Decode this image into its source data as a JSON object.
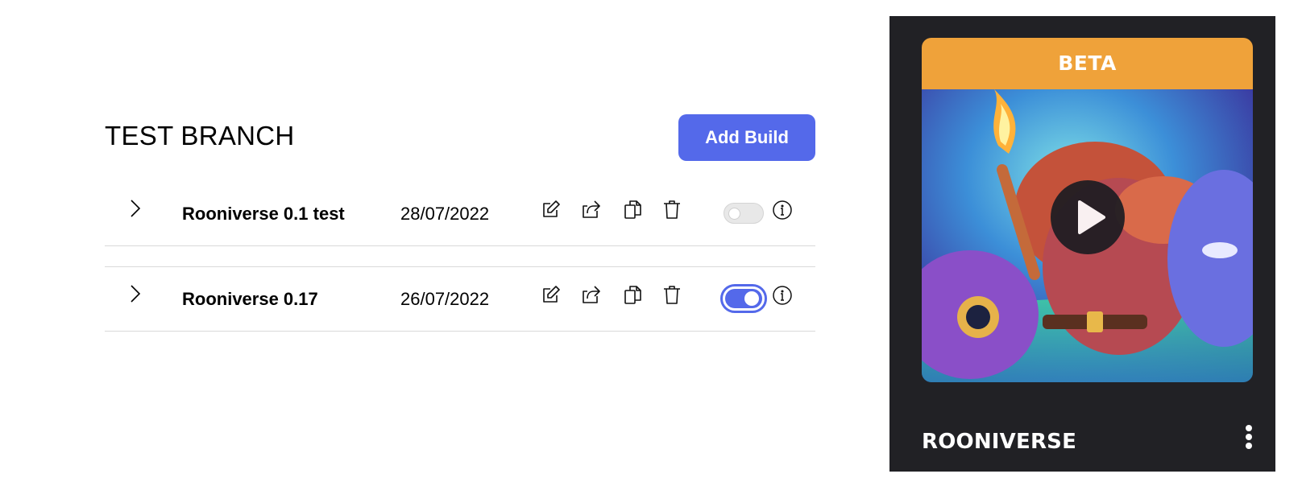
{
  "branch": {
    "title": "TEST BRANCH",
    "add_build_label": "Add Build"
  },
  "builds": [
    {
      "name": "Rooniverse 0.1 test",
      "date": "28/07/2022",
      "enabled": false
    },
    {
      "name": "Rooniverse 0.17",
      "date": "26/07/2022",
      "enabled": true
    }
  ],
  "icons": {
    "expand": "chevron-right-icon",
    "edit": "edit-icon",
    "share": "share-icon",
    "copy": "copy-icon",
    "delete": "trash-icon",
    "info": "info-icon",
    "play": "play-icon",
    "more": "more-vertical-icon"
  },
  "card": {
    "badge": "BETA",
    "title": "ROONIVERSE"
  },
  "colors": {
    "accent": "#5469ea",
    "badge": "#efa23a",
    "card_bg": "#212125",
    "divider": "#d9d9d9"
  }
}
